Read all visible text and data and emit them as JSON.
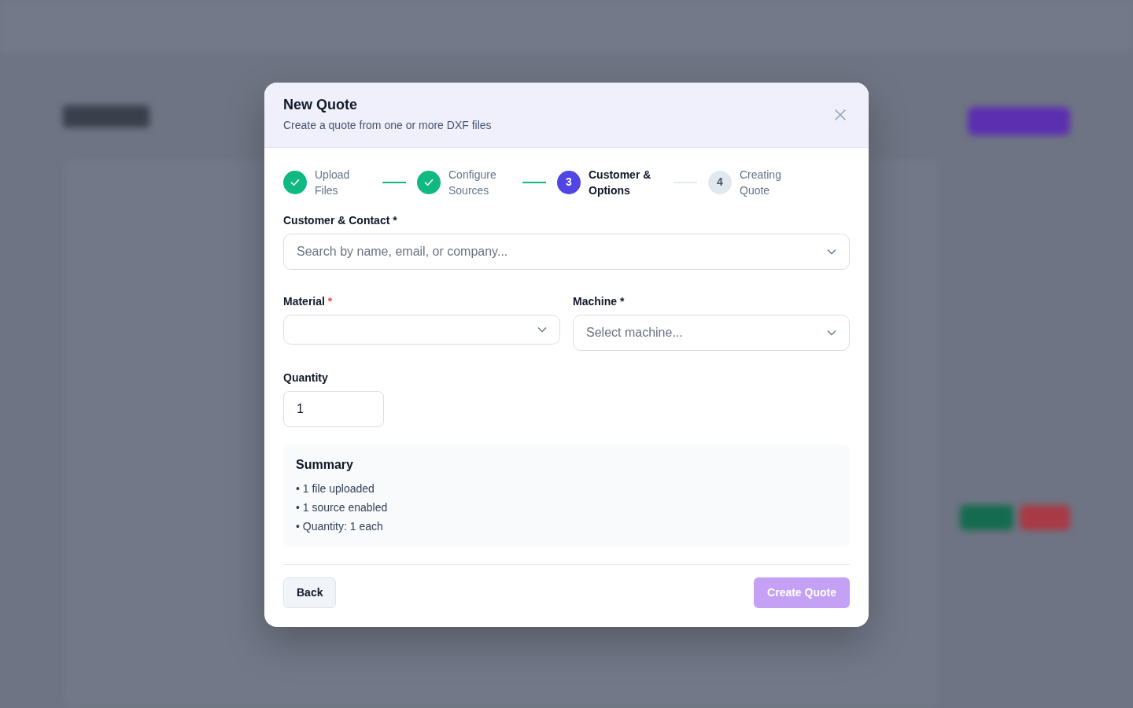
{
  "modal": {
    "title": "New Quote",
    "subtitle": "Create a quote from one or more DXF files"
  },
  "steps": [
    {
      "label": "Upload Files",
      "done": true,
      "current": false
    },
    {
      "label": "Configure Sources",
      "done": true,
      "current": false
    },
    {
      "number": "3",
      "label": "Customer & Options",
      "done": false,
      "current": true
    },
    {
      "number": "4",
      "label": "Creating Quote",
      "done": false,
      "current": false
    }
  ],
  "customer_field": {
    "label": "Customer & Contact",
    "required_mark": "*",
    "color": "#111827",
    "placeholder": "Search by name, email, or company..."
  },
  "material_field": {
    "label": "Material",
    "required_mark": "*",
    "color": "#ef4444"
  },
  "machine_field": {
    "label": "Machine",
    "required_mark": "*",
    "color": "#111827",
    "placeholder": "Select machine..."
  },
  "quantity_field": {
    "label": "Quantity",
    "value": "1"
  },
  "summary": {
    "title": "Summary",
    "bullet": "•",
    "items": [
      "1 file uploaded",
      "1 source enabled",
      "Quantity: 1 each"
    ]
  },
  "buttons": {
    "back": "Back",
    "create": {
      "label": "Create Quote",
      "disabled": true
    }
  }
}
